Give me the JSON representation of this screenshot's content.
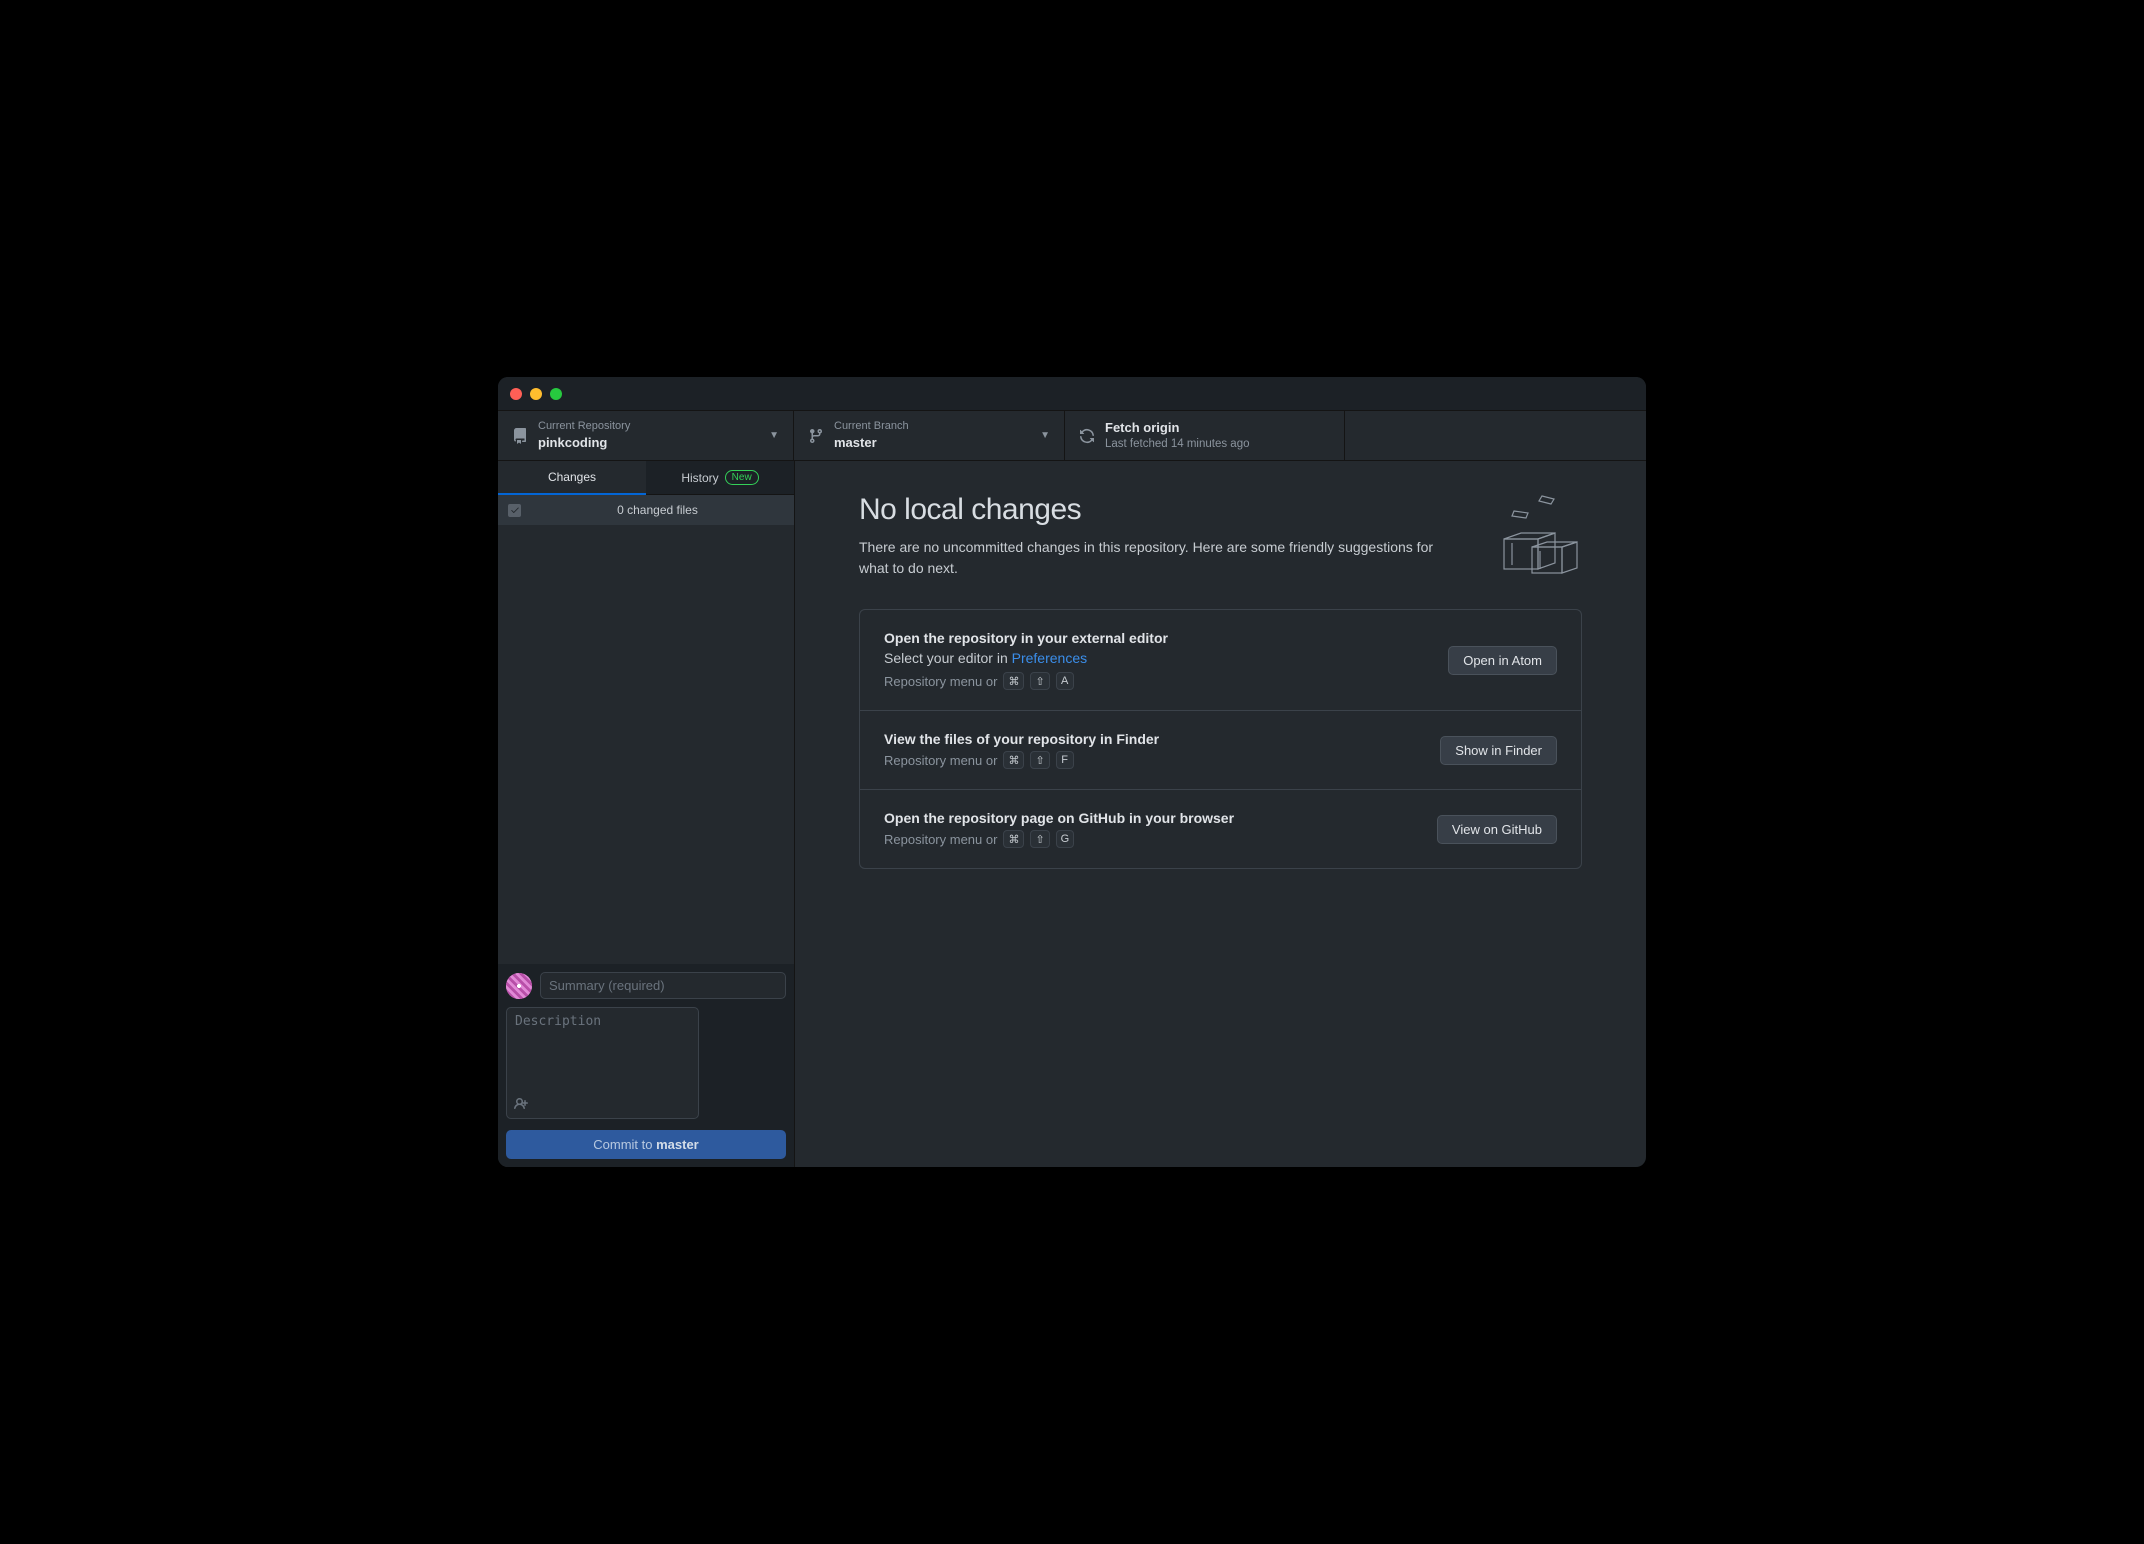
{
  "toolbar": {
    "repo": {
      "label": "Current Repository",
      "value": "pinkcoding"
    },
    "branch": {
      "label": "Current Branch",
      "value": "master"
    },
    "fetch": {
      "label": "Fetch origin",
      "sub": "Last fetched 14 minutes ago"
    }
  },
  "sidebar": {
    "tabs": {
      "changes": "Changes",
      "history": "History",
      "badge": "New"
    },
    "changes_header": "0 changed files"
  },
  "commit": {
    "summary_placeholder": "Summary (required)",
    "description_placeholder": "Description",
    "button_prefix": "Commit to ",
    "button_branch": "master"
  },
  "main": {
    "title": "No local changes",
    "subtitle": "There are no uncommitted changes in this repository. Here are some friendly suggestions for what to do next.",
    "cards": [
      {
        "title": "Open the repository in your external editor",
        "line_prefix": "Select your editor in ",
        "link": "Preferences",
        "hint_prefix": "Repository menu or",
        "keys": [
          "⌘",
          "⇧",
          "A"
        ],
        "button": "Open in Atom"
      },
      {
        "title": "View the files of your repository in Finder",
        "hint_prefix": "Repository menu or",
        "keys": [
          "⌘",
          "⇧",
          "F"
        ],
        "button": "Show in Finder"
      },
      {
        "title": "Open the repository page on GitHub in your browser",
        "hint_prefix": "Repository menu or",
        "keys": [
          "⌘",
          "⇧",
          "G"
        ],
        "button": "View on GitHub"
      }
    ]
  }
}
